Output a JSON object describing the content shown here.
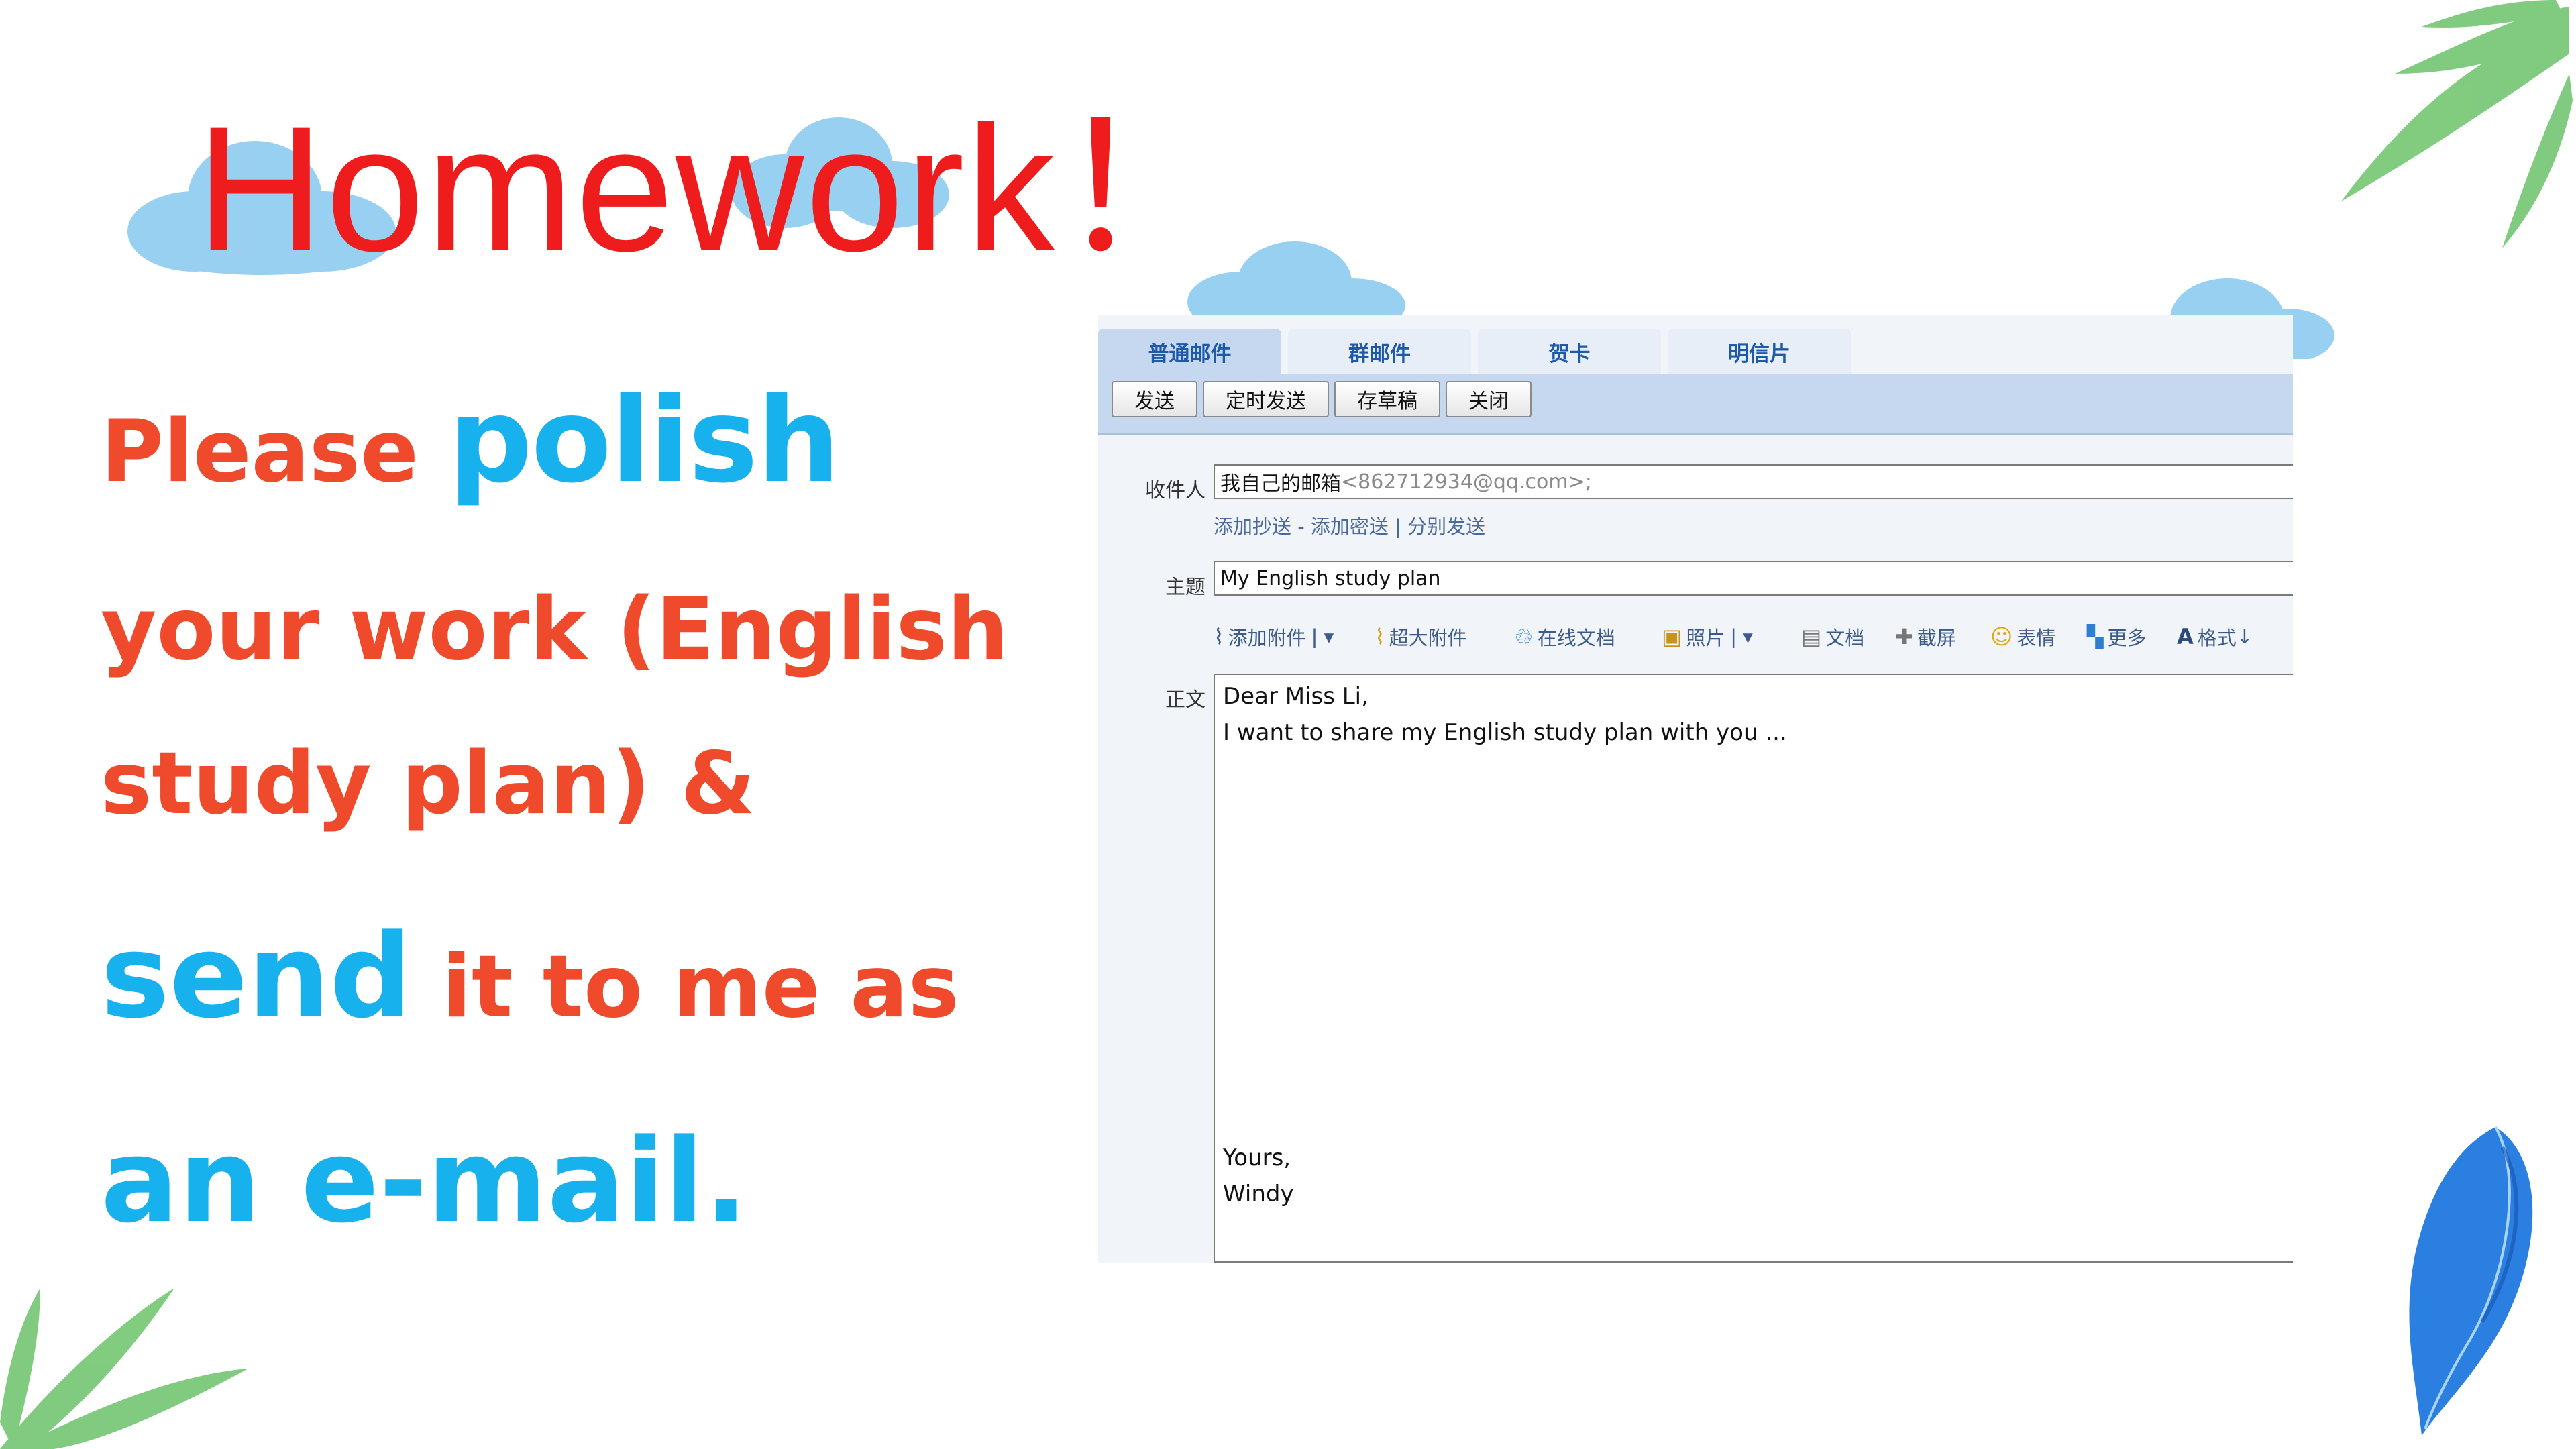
{
  "slide": {
    "title": "Homework！",
    "line1_a": "Please ",
    "line1_b": "polish",
    "line2": "your work (English",
    "line3": "study plan) &",
    "line4_a": "send",
    "line4_b": " it to me as",
    "line5": "an e-mail."
  },
  "colors": {
    "title": "#ee1c1c",
    "orange": "#ef4a2c",
    "blue": "#17b2ee",
    "leaf": "#6cc36a",
    "cloud": "#7cc3e8"
  },
  "mail": {
    "tabs": [
      "普通邮件",
      "群邮件",
      "贺卡",
      "明信片"
    ],
    "toolbar": [
      "发送",
      "定时发送",
      "存草稿",
      "关闭"
    ],
    "to_label": "收件人",
    "to_name": "我自己的邮箱",
    "to_address": "<862712934@qq.com>;",
    "cc_links": "添加抄送 - 添加密送 | 分别发送",
    "subject_label": "主题",
    "subject_value": "My English study plan",
    "format_items": [
      "添加附件",
      "超大附件",
      "在线文档",
      "照片",
      "文档",
      "截屏",
      "表情",
      "更多",
      "格式"
    ],
    "format_icons": [
      "paperclip-icon",
      "big-attachment-icon",
      "cloud-doc-icon",
      "photo-icon",
      "document-icon",
      "screenshot-icon",
      "emoji-icon",
      "more-icon",
      "format-icon"
    ],
    "body_label": "正文",
    "body_lines": [
      "Dear Miss Li,",
      "I want to share my English study plan with you ...",
      "Yours,",
      "Windy"
    ]
  }
}
